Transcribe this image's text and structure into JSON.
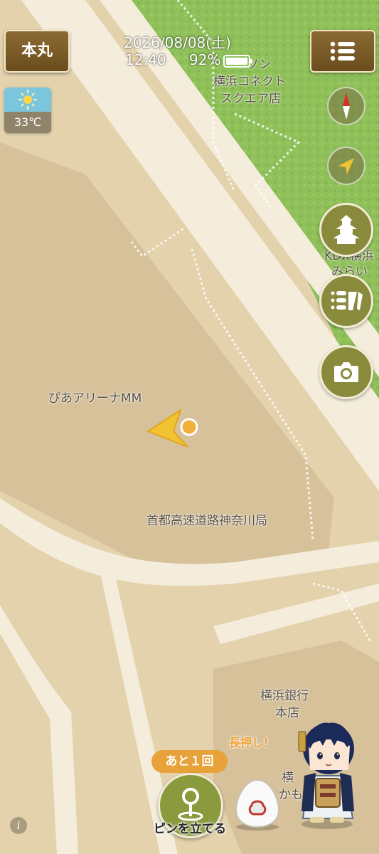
{
  "status_bar": {
    "date": "2026/08/08(土)",
    "time": "12:40",
    "battery": "92%"
  },
  "header": {
    "honmaru_label": "本丸",
    "menu_icon": "list-icon"
  },
  "weather": {
    "icon": "sun-icon",
    "temperature": "33℃"
  },
  "map": {
    "labels": {
      "lawson": "ソン",
      "connect": "横浜コネクト",
      "connect2": "スクエア店",
      "kdx": "KDX横浜",
      "kdx2": "みらい",
      "pia": "ぴあアリーナMM",
      "expressway": "首都高速道路神奈川局",
      "bank": "横浜銀行",
      "bank2": "本店",
      "other": "横",
      "other2": "かも"
    }
  },
  "right_controls": [
    "compass-icon",
    "locate-icon",
    "castle-icon",
    "touken-icon",
    "camera-icon"
  ],
  "bottom": {
    "remaining": "あと１回",
    "pin_label": "ピンを立てる",
    "long_press": "長押し！",
    "info": "i"
  },
  "colors": {
    "gold_button": "#7a5a28",
    "olive_button": "#8a8a3c",
    "orange_badge": "#e8a23a",
    "park_green": "#8fc05a"
  }
}
